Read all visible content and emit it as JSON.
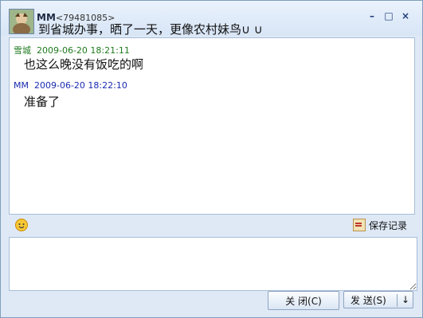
{
  "window": {
    "nick": "MM",
    "uid": "<79481085>",
    "signature": "到省城办事，晒了一天，更像农村妹鸟∪ ∪",
    "controls": {
      "minimize": "–",
      "maximize": "□",
      "close": "×"
    }
  },
  "messages": [
    {
      "sender": "雪城",
      "time": "2009-06-20 18:21:11",
      "text": "也这么晚没有饭吃的啊",
      "color": "#1f7a1f"
    },
    {
      "sender": "MM",
      "time": "2009-06-20 18:22:10",
      "text": "准备了",
      "color": "#1a2bb0"
    }
  ],
  "toolbar": {
    "emoji_icon": "smiley-icon",
    "save_record": "保存记录"
  },
  "input": {
    "value": ""
  },
  "buttons": {
    "close_label": "关 闭(C)",
    "send_label": "发 送(S)",
    "dropdown_arrow": "↓"
  }
}
